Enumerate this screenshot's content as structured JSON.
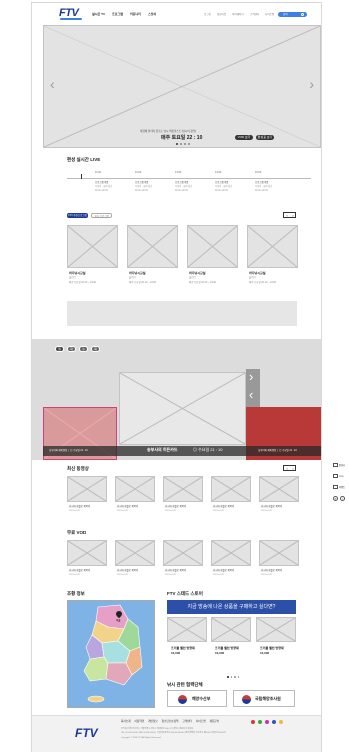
{
  "header": {
    "logo": "FTV",
    "nav": [
      "실시간 TV",
      "프로그램",
      "커뮤니티",
      "스토어"
    ],
    "utils": [
      "로그인",
      "회원가입",
      "마이페이지",
      "고객센터",
      "사이트맵"
    ],
    "search_label": "검색"
  },
  "hero": {
    "caption": "바람에 날리며 꿈꾸는 낚시 버킷리스트 [낚시의 정석]",
    "air_time": "매주 토요일 22 : 10",
    "btn_vod": "VOD 보기",
    "btn_replay": "편성표 보기"
  },
  "live": {
    "title": "편성 실시간 LIVE",
    "times": [
      "11:00",
      "12:00",
      "13:00",
      "14:00",
      "15:00"
    ],
    "program": "프로그램 이름",
    "program_sub": "부제목 ∙ 회차 정보",
    "program_time": "00:00~00:00"
  },
  "recommend": {
    "tab_active": "FTV 추천프로그램",
    "tab_inactive": "인기 프로그램",
    "cards": [
      {
        "title": "바다낚시교실",
        "sub": "출연진",
        "time": "매주 토요일 22:10 ~ 23:00"
      },
      {
        "title": "바다낚시교실",
        "sub": "출연진",
        "time": "매주 토요일 22:10 ~ 23:00"
      },
      {
        "title": "바다낚시교실",
        "sub": "출연진",
        "time": "매주 토요일 22:10 ~ 23:00"
      },
      {
        "title": "바다낚시교실",
        "sub": "출연진",
        "time": "매주 토요일 22:10 ~ 23:00"
      }
    ]
  },
  "schedule": {
    "days": [
      "월",
      "화",
      "수",
      "목"
    ],
    "left": "실루어의 해외원정 │ ◎ 수요일 21 : 10",
    "center_title": "송부사의 히든카드",
    "center_time": "◎ 수요일 21 : 10",
    "right": "실루어의 해외원정 │ ◎ 수요일 21 : 10"
  },
  "latest": {
    "title": "최신 동영상",
    "cards": [
      {
        "title": "낚싯대 카를로 제목이",
        "date": "2023.00.00"
      },
      {
        "title": "낚싯대 카를로 제목이",
        "date": "2023.00.00"
      },
      {
        "title": "낚싯대 카를로 제목이",
        "date": "2023.00.00"
      },
      {
        "title": "낚싯대 카를로 제목이",
        "date": "2023.00.00"
      },
      {
        "title": "낚싯대 카를로 제목이",
        "date": "2023.00.00"
      }
    ]
  },
  "free_vod": {
    "title": "무료 VOD",
    "cards": [
      {
        "title": "낚싯대 카를로 제목이",
        "date": "2023.00.00"
      },
      {
        "title": "낚싯대 카를로 제목이",
        "date": "2023.00.00"
      },
      {
        "title": "낚싯대 카를로 제목이",
        "date": "2023.00.00"
      },
      {
        "title": "낚싯대 카를로 제목이",
        "date": "2023.00.00"
      },
      {
        "title": "낚싯대 카를로 제목이",
        "date": "2023.00.00"
      }
    ]
  },
  "fishing_info": {
    "title": "조황 정보",
    "pin": "서울"
  },
  "store": {
    "title": "FTV 스테드 스토어",
    "banner": "지금 방송에 나온 상품을 구매하고 싶다면?",
    "items": [
      {
        "name": "프리폴 밸런 방향재",
        "price": "10,000"
      },
      {
        "name": "프리폴 밸런 방향재",
        "price": "10,000"
      },
      {
        "name": "프리폴 밸런 방향재",
        "price": "10,000"
      }
    ]
  },
  "related": {
    "title": "낚시 관련 협력단체",
    "org1": "해양수산부",
    "org2": "국립해양조사원"
  },
  "quick": [
    "편성표",
    "VOD",
    "이벤트"
  ],
  "footer": {
    "logo": "FTV",
    "links": [
      "회사소개",
      "이용약관",
      "개인정보",
      "청소년보호정책",
      "고객센터",
      "사이트맵",
      "제휴문의"
    ],
    "address": "주식회사 에프티브이 | 서울특별시 강남구 테헤란로 000, FTV빌딩 | 대표이사 홍길동",
    "info": "TEL 02-000-0000 | FAX 02-000-0000 | 사업자등록번호 000-00-00000 | 통신판매업 신고번호 제0000-서울강남-0000호",
    "copyright": "Copyright © 2023 FTV All Rights Reserved."
  },
  "colors": {
    "brand": "#1c3a99",
    "accent": "#3f7fe0",
    "red": "#c43c3c",
    "map_bg": "#7fb3e6"
  }
}
